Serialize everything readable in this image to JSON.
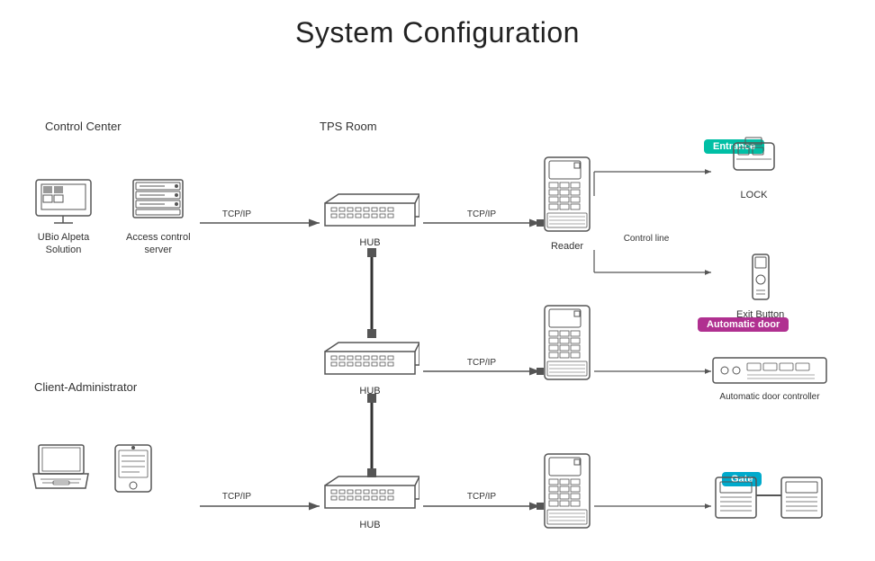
{
  "title": "System Configuration",
  "sections": {
    "control_center": "Control Center",
    "tps_room": "TPS Room",
    "client_admin": "Client-Administrator"
  },
  "badges": {
    "entrance": "Entrance",
    "automatic_door": "Automatic door",
    "gate": "Gate"
  },
  "devices": {
    "ubio": "UBio Alpeta\nSolution",
    "access_server": "Access control\nserver",
    "hub1": "HUB",
    "hub2": "HUB",
    "hub3": "HUB",
    "reader1": "Reader",
    "reader2": "",
    "reader3": "",
    "lock": "LOCK",
    "exit_button": "Exit Button",
    "control_line": "Control line",
    "auto_door_ctrl": "Automatic door controller",
    "gate_device": ""
  },
  "arrows": {
    "tcp_ip": "TCP/IP"
  },
  "colors": {
    "entrance": "#00bfa5",
    "automatic_door": "#b03090",
    "gate": "#00aacc",
    "arrow": "#555",
    "device_stroke": "#555"
  }
}
